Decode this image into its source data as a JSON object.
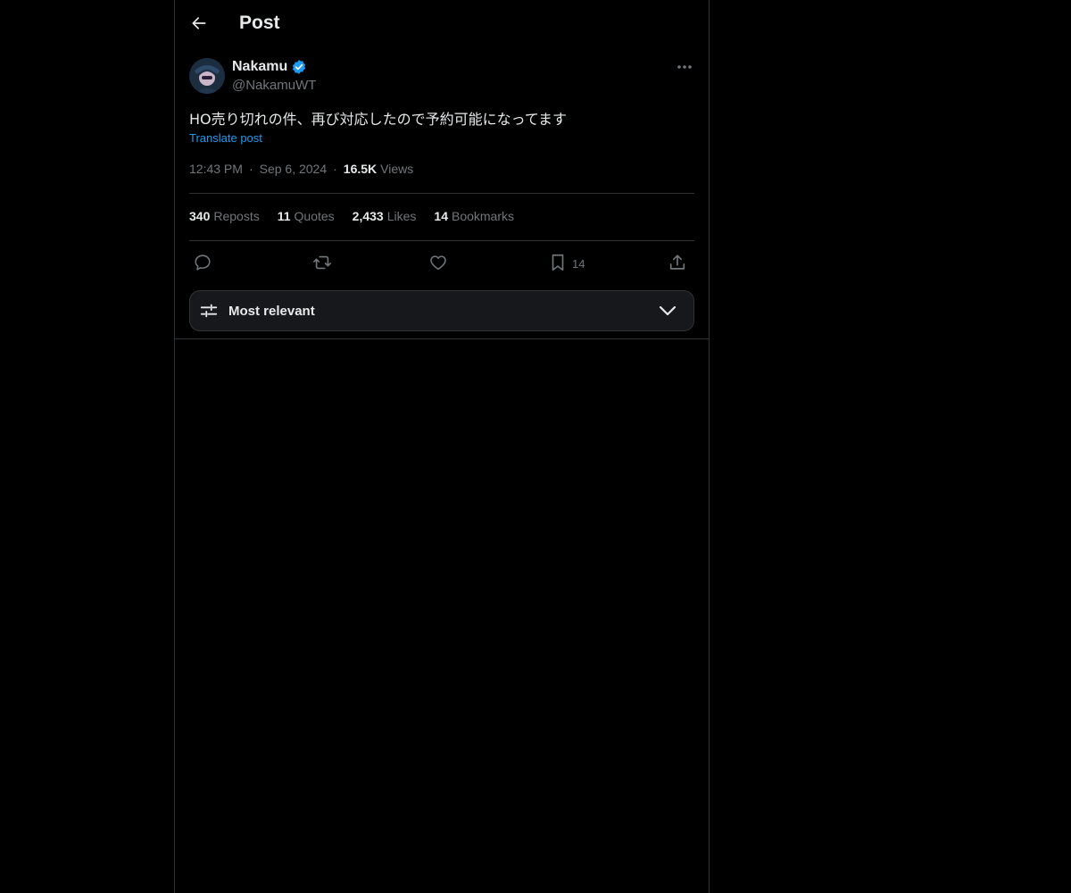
{
  "header": {
    "title": "Post"
  },
  "author": {
    "name": "Nakamu",
    "handle": "@NakamuWT",
    "verified": true
  },
  "post": {
    "text": "HO売り切れの件、再び対応したので予約可能になってます",
    "translate_label": "Translate post",
    "time": "12:43 PM",
    "date": "Sep 6, 2024",
    "views_count": "16.5K",
    "views_label": "Views"
  },
  "stats": [
    {
      "count": "340",
      "label": "Reposts"
    },
    {
      "count": "11",
      "label": "Quotes"
    },
    {
      "count": "2,433",
      "label": "Likes"
    },
    {
      "count": "14",
      "label": "Bookmarks"
    }
  ],
  "actions": {
    "bookmark_count": "14"
  },
  "sort": {
    "label": "Most relevant"
  },
  "colors": {
    "background": "#000000",
    "text": "#e7e9ea",
    "muted": "#71767b",
    "accent": "#1d9bf0",
    "border": "#2f3336"
  },
  "icons": {
    "back": "arrow-left-icon",
    "verified": "verified-badge-icon",
    "more": "more-horizontal-icon",
    "reply": "reply-icon",
    "repost": "repost-icon",
    "like": "heart-icon",
    "bookmark": "bookmark-icon",
    "share": "share-icon",
    "sort": "sliders-icon",
    "chevron": "chevron-down-icon"
  }
}
